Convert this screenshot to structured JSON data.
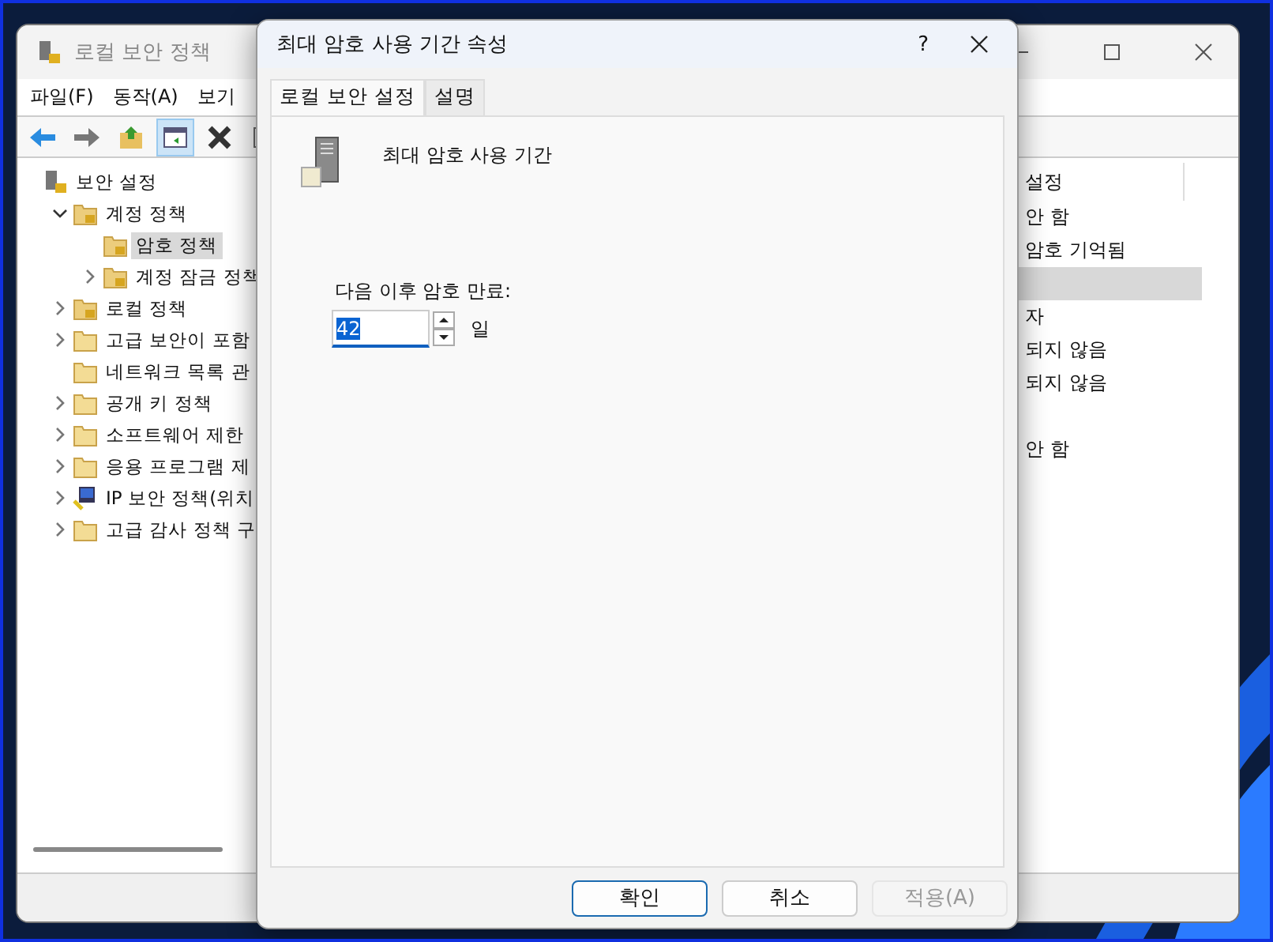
{
  "main_window": {
    "title": "로컬 보안 정책",
    "menu": [
      "파일(F)",
      "동작(A)",
      "보기"
    ],
    "toolbar": [
      {
        "kind": "back",
        "pressed": false
      },
      {
        "kind": "forward",
        "pressed": false
      },
      {
        "kind": "up",
        "pressed": false
      },
      {
        "kind": "tree",
        "pressed": true
      },
      {
        "kind": "delete",
        "pressed": false
      },
      {
        "kind": "properties",
        "pressed": false
      }
    ],
    "tree": [
      {
        "label": "보안 설정",
        "kind": "root",
        "selected": false,
        "children": [
          {
            "label": "계정 정책",
            "kind": "lock",
            "expanded": true,
            "selected": false,
            "children": [
              {
                "label": "암호 정책",
                "kind": "lock",
                "selected": true
              },
              {
                "label": "계정 잠금 정책",
                "kind": "lock",
                "expanded": false,
                "selected": false
              }
            ]
          },
          {
            "label": "로컬 정책",
            "kind": "lock",
            "expanded": false,
            "selected": false
          },
          {
            "label": "고급 보안이 포함",
            "kind": "folder",
            "expanded": false,
            "selected": false
          },
          {
            "label": "네트워크 목록 관",
            "kind": "folder",
            "selected": false
          },
          {
            "label": "공개 키 정책",
            "kind": "folder",
            "expanded": false,
            "selected": false
          },
          {
            "label": "소프트웨어 제한",
            "kind": "folder",
            "expanded": false,
            "selected": false
          },
          {
            "label": "응용 프로그램 제",
            "kind": "folder",
            "expanded": false,
            "selected": false
          },
          {
            "label": "IP 보안 정책(위치",
            "kind": "ipsec",
            "expanded": false,
            "selected": false
          },
          {
            "label": "고급 감사 정책 구",
            "kind": "folder",
            "expanded": false,
            "selected": false
          }
        ]
      }
    ],
    "list_header": "설정",
    "list_rows": [
      {
        "text": "안 함",
        "selected": false
      },
      {
        "text": "암호 기억됨",
        "selected": false
      },
      {
        "text": "",
        "selected": true
      },
      {
        "text": "자",
        "selected": false
      },
      {
        "text": "되지 않음",
        "selected": false
      },
      {
        "text": "되지 않음",
        "selected": false
      },
      {
        "text": "",
        "selected": false
      },
      {
        "text": "안 함",
        "selected": false
      }
    ]
  },
  "dialog": {
    "title": "최대 암호 사용 기간 속성",
    "help": "?",
    "tabs": [
      {
        "label": "로컬 보안 설정",
        "selected": true
      },
      {
        "label": "설명",
        "selected": false
      }
    ],
    "heading": "최대 암호 사용 기간",
    "field_label": "다음 이후 암호 만료:",
    "value": "42",
    "unit": "일",
    "buttons": [
      {
        "label": "확인",
        "kind": "default",
        "disabled": false
      },
      {
        "label": "취소",
        "kind": "normal",
        "disabled": false
      },
      {
        "label": "적용(A)",
        "kind": "normal",
        "disabled": true
      }
    ]
  }
}
